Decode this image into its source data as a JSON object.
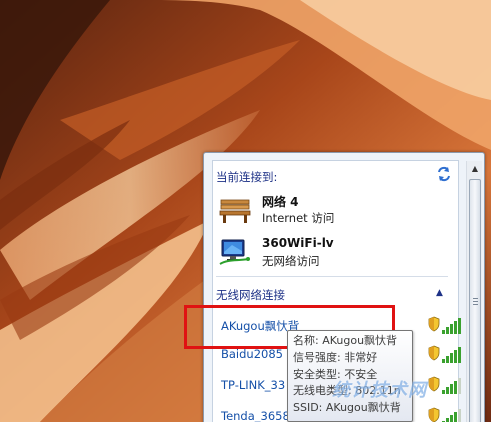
{
  "current_connection": {
    "title": "当前连接到:",
    "networks": [
      {
        "name": "网络  4",
        "status": "Internet 访问",
        "icon": "bench-network-icon"
      },
      {
        "name": "360WiFi-lv",
        "status": "无网络访问",
        "icon": "monitor-network-icon"
      }
    ]
  },
  "wireless": {
    "title": "无线网络连接",
    "networks": [
      {
        "name": "AKugou飘忕背",
        "secured": true,
        "signal": 5
      },
      {
        "name": "Baidu2085",
        "secured": true,
        "signal": 5
      },
      {
        "name": "TP-LINK_33",
        "secured": true,
        "signal": 4
      },
      {
        "name": "Tenda_3658",
        "secured": true,
        "signal": 4
      }
    ]
  },
  "tooltip": {
    "lines": [
      "名称: AKugou飘忕背",
      "信号强度: 非常好",
      "安全类型: 不安全",
      "无线电类型: 802.11n",
      "SSID: AKugou飘忕背"
    ]
  },
  "watermark": "统计技术网",
  "colors": {
    "accent_link": "#1550a8",
    "section_title": "#1e3287",
    "highlight": "#e01212",
    "signal": "#3aa12e"
  }
}
